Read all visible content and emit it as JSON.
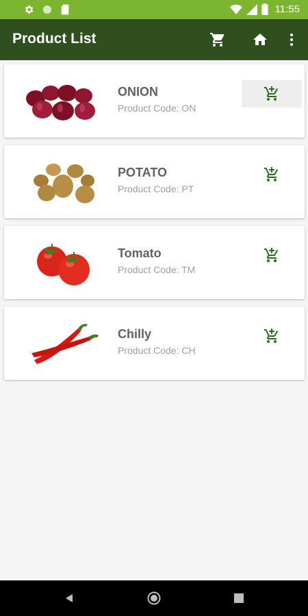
{
  "status_bar": {
    "time": "11:55",
    "left_icons": [
      "settings-icon",
      "circle-icon",
      "sd-card-icon"
    ],
    "right_icons": [
      "wifi-icon",
      "signal-icon",
      "battery-icon"
    ],
    "color": "#7cb631"
  },
  "app_bar": {
    "title": "Product List",
    "actions": [
      "cart-icon",
      "home-icon",
      "more-vert-icon"
    ],
    "color": "#2f4f1f"
  },
  "products": [
    {
      "name": "ONION",
      "code": "Product Code: ON",
      "image": "onion"
    },
    {
      "name": "POTATO",
      "code": "Product Code: PT",
      "image": "potato"
    },
    {
      "name": "Tomato",
      "code": "Product Code: TM",
      "image": "tomato"
    },
    {
      "name": "Chilly",
      "code": "Product Code: CH",
      "image": "chilly"
    }
  ],
  "accent_color": "#2e6b1f",
  "nav_bar": {
    "buttons": [
      "back-icon",
      "home-circle-icon",
      "recents-icon"
    ]
  }
}
